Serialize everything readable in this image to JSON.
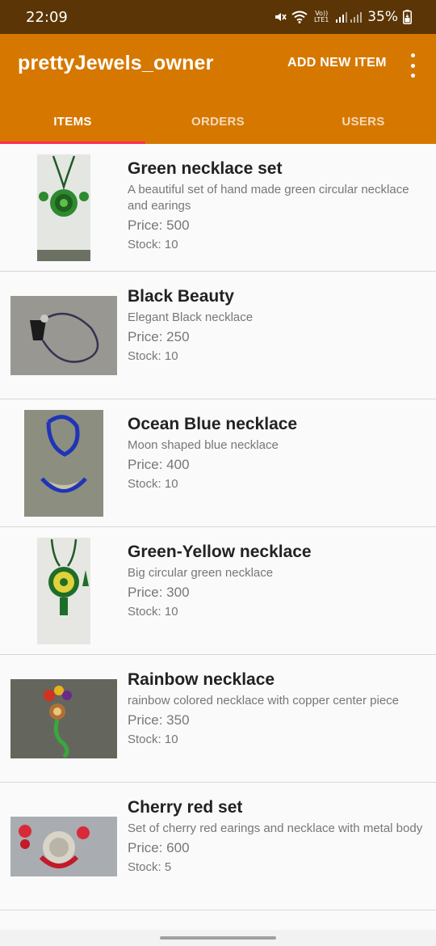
{
  "status_bar": {
    "time": "22:09",
    "volte_label": "Vo)) LTE1",
    "battery": "35%",
    "icons": [
      "mute-icon",
      "wifi-icon",
      "signal-icon",
      "battery-icon"
    ]
  },
  "app_bar": {
    "title": "prettyJewels_owner",
    "add_label": "ADD NEW ITEM",
    "menu_icon": "overflow-menu-icon"
  },
  "tabs": [
    {
      "label": "ITEMS",
      "active": true
    },
    {
      "label": "ORDERS",
      "active": false
    },
    {
      "label": "USERS",
      "active": false
    }
  ],
  "items": [
    {
      "name": "Green necklace set",
      "description": "A beautiful set of hand made green circular necklace and earings",
      "price": "Price: 500",
      "stock": "Stock: 10"
    },
    {
      "name": "Black Beauty",
      "description": "Elegant Black necklace",
      "price": "Price: 250",
      "stock": "Stock: 10"
    },
    {
      "name": "Ocean Blue necklace",
      "description": "Moon shaped blue necklace",
      "price": "Price: 400",
      "stock": "Stock: 10"
    },
    {
      "name": "Green-Yellow necklace",
      "description": "Big circular green necklace",
      "price": "Price: 300",
      "stock": "Stock: 10"
    },
    {
      "name": "Rainbow necklace",
      "description": "rainbow colored necklace with copper center piece",
      "price": "Price: 350",
      "stock": "Stock: 10"
    },
    {
      "name": "Cherry red set",
      "description": "Set of cherry red earings and necklace with metal body",
      "price": "Price: 600",
      "stock": "Stock: 5"
    }
  ],
  "colors": {
    "status_bar": "#5b3505",
    "app_bar": "#d67800",
    "tab_indicator": "#ff2d55"
  }
}
